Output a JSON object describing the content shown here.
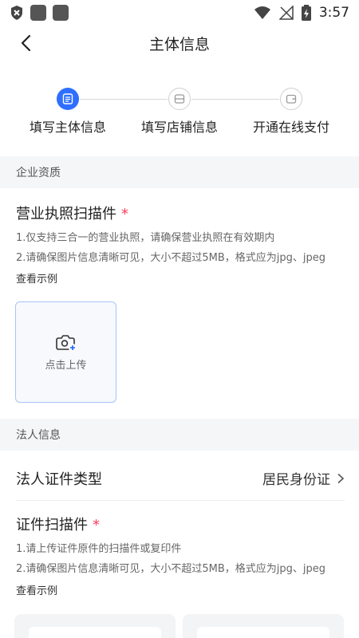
{
  "status_bar": {
    "time": "3:57"
  },
  "nav": {
    "title": "主体信息"
  },
  "steps": [
    {
      "label": "填写主体信息",
      "active": true
    },
    {
      "label": "填写店铺信息",
      "active": false
    },
    {
      "label": "开通在线支付",
      "active": false
    }
  ],
  "section_company": {
    "title": "企业资质"
  },
  "license": {
    "title": "营业执照扫描件",
    "required_mark": "*",
    "hint1": "1.仅支持三合一的营业执照，请确保营业执照在有效期内",
    "hint2": "2.请确保图片信息清晰可见，大小不超过5MB，格式应为jpg、jpeg",
    "example": "查看示例",
    "upload_label": "点击上传"
  },
  "section_legal": {
    "title": "法人信息"
  },
  "id_type": {
    "label": "法人证件类型",
    "value": "居民身份证"
  },
  "id_scan": {
    "title": "证件扫描件",
    "required_mark": "*",
    "hint1": "1.请上传证件原件的扫描件或复印件",
    "hint2": "2.请确保图片信息清晰可见，大小不超过5MB，格式应为jpg、jpeg",
    "example": "查看示例"
  },
  "colors": {
    "accent": "#2f6fff",
    "required": "#ff3b5c",
    "section_bg": "#f5f6f8"
  }
}
